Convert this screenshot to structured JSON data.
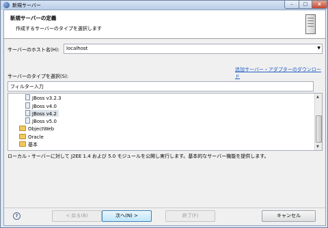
{
  "window": {
    "title": "新規サーバー",
    "close_label": "x"
  },
  "banner": {
    "title": "新規サーバーの定義",
    "description": "作成するサーバーのタイプを選択します"
  },
  "host": {
    "label": "サーバーのホスト名(H):",
    "value": "localhost",
    "arrow": "▼"
  },
  "download_link": "追加サーバー・アダプターのダウンロード",
  "server_type": {
    "label": "サーバーのタイプを選択(S):",
    "filter_placeholder": "フィルター入力"
  },
  "tree": {
    "items": [
      {
        "label": "JBoss v3.2.3",
        "kind": "jboss",
        "selected": false
      },
      {
        "label": "JBoss v4.0",
        "kind": "jboss",
        "selected": false
      },
      {
        "label": "JBoss v4.2",
        "kind": "jboss",
        "selected": true
      },
      {
        "label": "JBoss v5.0",
        "kind": "jboss",
        "selected": false
      },
      {
        "label": "ObjectWeb",
        "kind": "folder",
        "selected": false
      },
      {
        "label": "Oracle",
        "kind": "folder",
        "selected": false
      },
      {
        "label": "基本",
        "kind": "folder",
        "selected": false
      }
    ]
  },
  "description": "ローカル・サーバーに対して J2EE 1.4 および 5.0 モジュールを公開し実行します。基本的なサーバー機能を提供します。",
  "buttons": {
    "help": "?",
    "back": "< 戻る(B)",
    "next": "次へ(N) >",
    "finish": "終了(F)",
    "cancel": "キャンセル"
  }
}
